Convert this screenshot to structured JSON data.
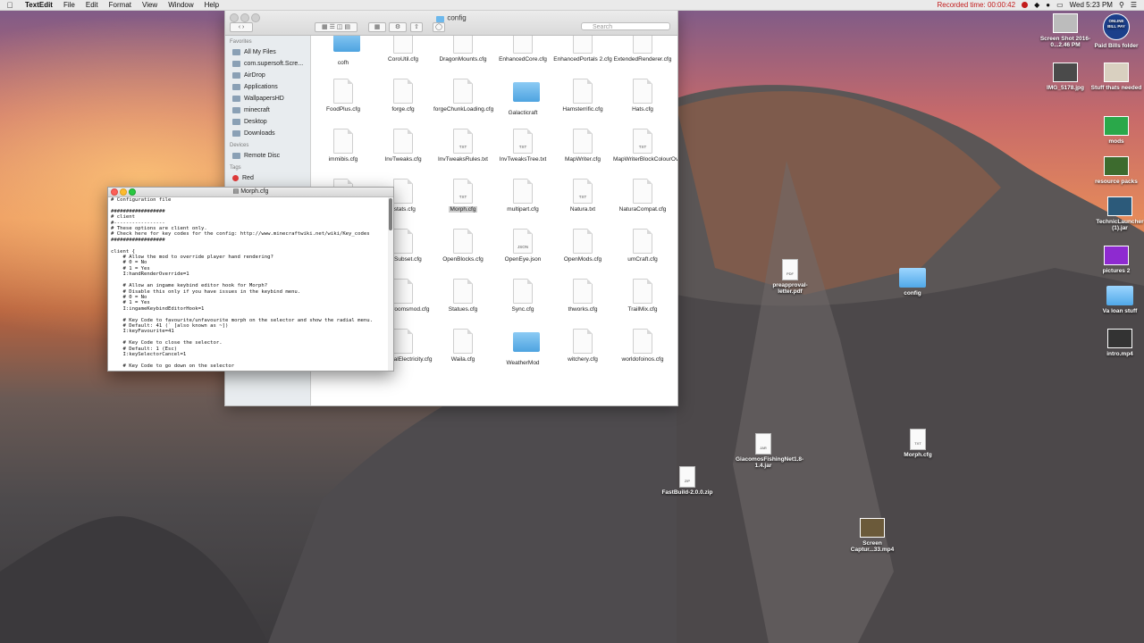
{
  "menubar": {
    "app": "TextEdit",
    "menus": [
      "File",
      "Edit",
      "Format",
      "View",
      "Window",
      "Help"
    ],
    "recorded": "Recorded time: 00:00:42",
    "clock": "Wed 5:23 PM"
  },
  "finder": {
    "title": "config",
    "search_placeholder": "Search",
    "sidebar": {
      "favorites_header": "Favorites",
      "favorites": [
        "All My Files",
        "com.supersoft.Scre...",
        "AirDrop",
        "Applications",
        "WallpapersHD",
        "minecraft",
        "Desktop",
        "Downloads"
      ],
      "devices_header": "Devices",
      "devices": [
        "Remote Disc"
      ],
      "tags_header": "Tags",
      "tags": [
        "Red"
      ]
    },
    "files": [
      {
        "name": "cofh",
        "kind": "folder"
      },
      {
        "name": "CoroUtil.cfg",
        "kind": "doc"
      },
      {
        "name": "DragonMounts.cfg",
        "kind": "doc"
      },
      {
        "name": "EnhancedCore.cfg",
        "kind": "doc"
      },
      {
        "name": "EnhancedPortals 2.cfg",
        "kind": "doc"
      },
      {
        "name": "ExtendedRenderer.cfg",
        "kind": "doc"
      },
      {
        "name": "FoodPlus.cfg",
        "kind": "doc"
      },
      {
        "name": "forge.cfg",
        "kind": "doc"
      },
      {
        "name": "forgeChunkLoading.cfg",
        "kind": "doc"
      },
      {
        "name": "Galacticraft",
        "kind": "folder"
      },
      {
        "name": "Hamsterrific.cfg",
        "kind": "doc"
      },
      {
        "name": "Hats.cfg",
        "kind": "doc"
      },
      {
        "name": "immibis.cfg",
        "kind": "doc"
      },
      {
        "name": "InvTweaks.cfg",
        "kind": "doc"
      },
      {
        "name": "InvTweaksRules.txt",
        "kind": "txt"
      },
      {
        "name": "InvTweaksTree.txt",
        "kind": "txt"
      },
      {
        "name": "MapWriter.cfg",
        "kind": "doc"
      },
      {
        "name": "MapWriterBlockColourOverrides.txt",
        "kind": "txt"
      },
      {
        "name": "",
        "kind": "doc"
      },
      {
        "name": "dstats.cfg",
        "kind": "doc"
      },
      {
        "name": "Morph.cfg",
        "kind": "txt"
      },
      {
        "name": "multipart.cfg",
        "kind": "doc"
      },
      {
        "name": "Natura.txt",
        "kind": "txt"
      },
      {
        "name": "NaturaCompat.cfg",
        "kind": "doc"
      },
      {
        "name": "Server.cfg",
        "kind": "doc"
      },
      {
        "name": "NEISubset.cfg",
        "kind": "doc"
      },
      {
        "name": "OpenBlocks.cfg",
        "kind": "doc"
      },
      {
        "name": "OpenEye.json",
        "kind": "json"
      },
      {
        "name": "OpenMods.cfg",
        "kind": "doc"
      },
      {
        "name": "umCraft.cfg",
        "kind": "doc"
      },
      {
        "name": "RandomThings.cfg",
        "kind": "doc"
      },
      {
        "name": "secretroomsmod.cfg",
        "kind": "doc"
      },
      {
        "name": "Statues.cfg",
        "kind": "doc"
      },
      {
        "name": "Sync.cfg",
        "kind": "doc"
      },
      {
        "name": "thworks.cfg",
        "kind": "doc"
      },
      {
        "name": "TrailMix.cfg",
        "kind": "doc"
      },
      {
        "name": "Tropicraft",
        "kind": "folder"
      },
      {
        "name": "UniversalElectricity.cfg",
        "kind": "doc"
      },
      {
        "name": "Waila.cfg",
        "kind": "doc"
      },
      {
        "name": "WeatherMod",
        "kind": "folder"
      },
      {
        "name": "witchery.cfg",
        "kind": "doc"
      },
      {
        "name": "worldofoinos.cfg",
        "kind": "doc"
      }
    ],
    "file_tags": {
      "txt": "TXT",
      "json": "JSON"
    }
  },
  "textedit": {
    "title": "Morph.cfg",
    "content": "# Configuration file\n\n##################\n# client\n#-----------------\n# These options are client only.\n# Check here for key codes for the config: http://www.minecraftwiki.net/wiki/Key_codes\n##################\n\nclient {\n    # Allow the mod to override player hand rendering?\n    # 0 = No\n    # 1 = Yes\n    I:handRenderOverride=1\n\n    # Allow an ingame keybind editor hook for Morph?\n    # Disable this only if you have issues in the keybind menu.\n    # 0 = No\n    # 1 = Yes\n    I:ingameKeybindEditorHook=1\n\n    # Key Code to favourite/unfavourite morph on the selector and show the radial menu.\n    # Default: 41 (` [also known as ~])\n    I:keyFavourite=41\n\n    # Key Code to close the selector.\n    # Default: 1 (Esc)\n    I:keySelectorCancel=1\n\n    # Key Code to go down on the selector"
  },
  "desktop": [
    {
      "label": "Screen Shot 2016-0...2.46 PM",
      "kind": "thumb"
    },
    {
      "label": "Paid Bills folder",
      "kind": "logo"
    },
    {
      "label": "IMG_5178.jpg",
      "kind": "thumb"
    },
    {
      "label": "Stuff thats needed",
      "kind": "thumb"
    },
    {
      "label": "mods",
      "kind": "thumb"
    },
    {
      "label": "resource packs",
      "kind": "thumb"
    },
    {
      "label": "TechnicLauncher (1).jar",
      "kind": "thumb"
    },
    {
      "label": "pictures 2",
      "kind": "thumb"
    },
    {
      "label": "Va loan stuff",
      "kind": "folder"
    },
    {
      "label": "intro.mp4",
      "kind": "thumb"
    },
    {
      "label": "preapproval-letter.pdf",
      "kind": "pdf"
    },
    {
      "label": "config",
      "kind": "folder"
    },
    {
      "label": "GiacomosFishingNet1.8-1.4.jar",
      "kind": "jar"
    },
    {
      "label": "Morph.cfg",
      "kind": "txt"
    },
    {
      "label": "FastBuild-2.0.0.zip",
      "kind": "zip"
    },
    {
      "label": "Screen Captur...33.mp4",
      "kind": "thumb"
    }
  ],
  "desktop_tags": {
    "pdf": "PDF",
    "jar": "JAR",
    "txt": "TXT",
    "zip": "ZIP"
  },
  "logo_text": "ONLINE BILL PAY"
}
